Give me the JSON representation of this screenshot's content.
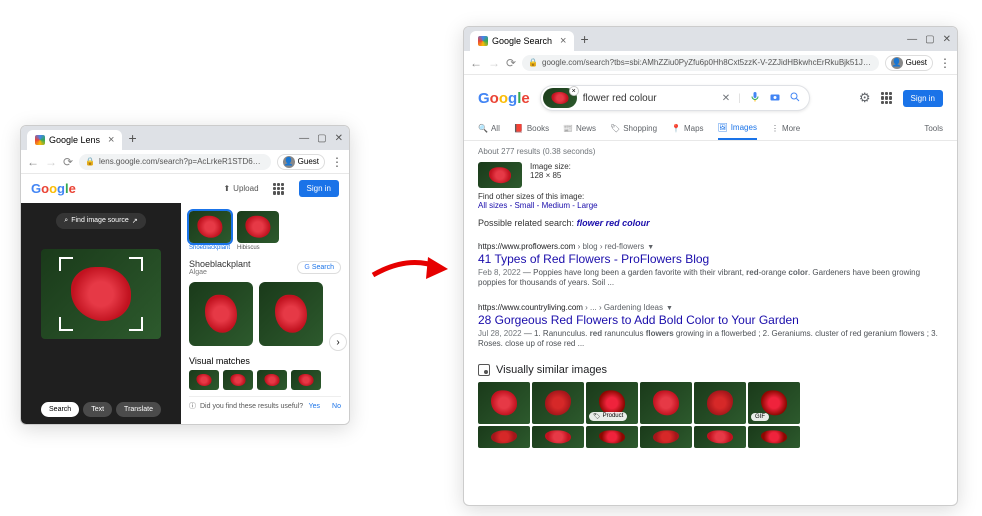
{
  "left_window": {
    "tab_title": "Google Lens",
    "url": "lens.google.com/search?p=AcLrkeR1STD6N9fdypL81u3kk8QH8zRLWkfgrVmksH87LX...L8...",
    "guest": "Guest",
    "logo": [
      "G",
      "o",
      "o",
      "g",
      "l",
      "e"
    ],
    "upload": "Upload",
    "signin": "Sign in",
    "find_source": "Find image source",
    "chips": {
      "search": "Search",
      "text": "Text",
      "translate": "Translate"
    },
    "thumbs": [
      {
        "label": "Shoeblackplant",
        "selected": true
      },
      {
        "label": "Hibiscus",
        "selected": false
      }
    ],
    "result_title": "Shoeblackplant",
    "result_sub": "Algae",
    "search_chip": "Search",
    "visual_matches": "Visual matches",
    "feedback_q": "Did you find these results useful?",
    "feedback_yes": "Yes",
    "feedback_no": "No"
  },
  "right_window": {
    "tab_title": "Google Search",
    "url": "google.com/search?tbs=sbi:AMhZZiu0PyZfu6p0Hh8Cxt5zzK-V-2ZJidHBkwhcErRkuBjk51JS0s8ZiITkcD7RX7LKv5U...",
    "guest": "Guest",
    "search_query": "flower red colour",
    "signin": "Sign in",
    "tabs": {
      "all": "All",
      "books": "Books",
      "news": "News",
      "shopping": "Shopping",
      "maps": "Maps",
      "images": "Images",
      "more": "More",
      "tools": "Tools"
    },
    "stats": "About 277 results (0.38 seconds)",
    "image_size_label": "Image size:",
    "image_size_value": "128 × 85",
    "find_other": "Find other sizes of this image:",
    "sizes": "All sizes - Small - Medium - Large",
    "related_label": "Possible related search:",
    "related_link": "flower red colour",
    "results": [
      {
        "cite_host": "https://www.proflowers.com",
        "cite_path": " › blog › red-flowers",
        "title": "41 Types of Red Flowers - ProFlowers Blog",
        "date": "Feb 8, 2022",
        "snippet_pre": " — Poppies have long been a garden favorite with their vibrant, ",
        "snippet_bold1": "red",
        "snippet_mid": "-orange ",
        "snippet_bold2": "color",
        "snippet_post": ". Gardeners have been growing poppies for thousands of years. Soil ..."
      },
      {
        "cite_host": "https://www.countryliving.com",
        "cite_path": " › ... › Gardening Ideas",
        "title": "28 Gorgeous Red Flowers to Add Bold Color to Your Garden",
        "date": "Jul 28, 2022",
        "snippet_pre": " — 1. Ranunculus. ",
        "snippet_bold1": "red",
        "snippet_mid": " ranunculus ",
        "snippet_bold2": "flowers",
        "snippet_post": " growing in a flowerbed ; 2. Geraniums. cluster of red geranium flowers ; 3. Roses. close up of rose red ..."
      }
    ],
    "vs_title": "Visually similar images",
    "vs_badges": {
      "product": "Product",
      "gif": "GIF"
    }
  }
}
